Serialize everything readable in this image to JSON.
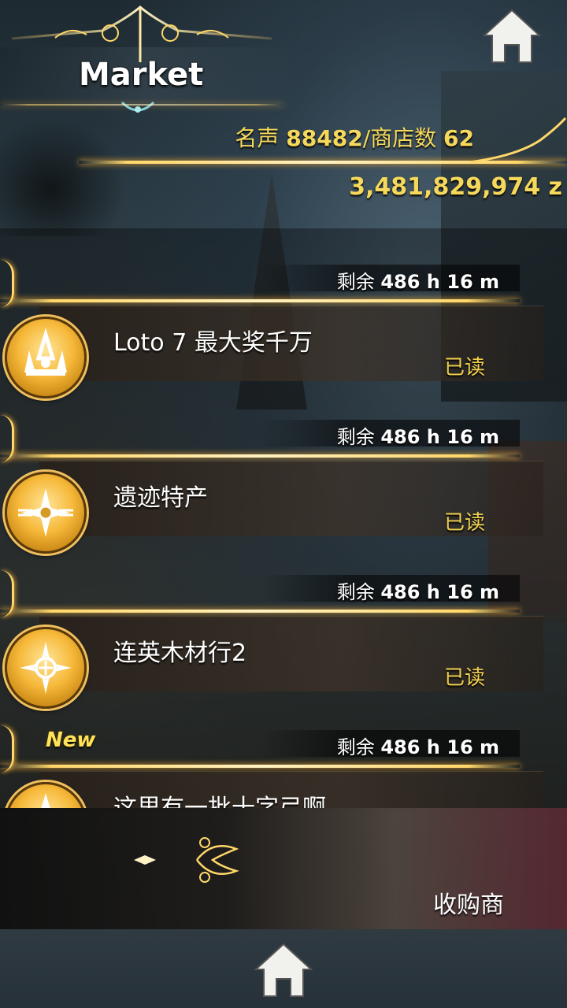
{
  "header": {
    "title": "Market",
    "home_icon": "home-icon"
  },
  "stats": {
    "fame_label": "名声",
    "fame_value": "88482",
    "shops_label": "/商店数",
    "shops_value": "62"
  },
  "money": "3,481,829,974 z",
  "entries": [
    {
      "remaining_label": "剩余",
      "remaining_value": "486 h 16 m",
      "title": "Loto 7 最大奖千万",
      "status": "已读",
      "icon": "crown-crest-icon",
      "new_badge": ""
    },
    {
      "remaining_label": "剩余",
      "remaining_value": "486 h 16 m",
      "title": "遗迹特产",
      "status": "已读",
      "icon": "compass-star-icon",
      "new_badge": ""
    },
    {
      "remaining_label": "剩余",
      "remaining_value": "486 h 16 m",
      "title": "连英木材行2",
      "status": "已读",
      "icon": "crosshair-emblem-icon",
      "new_badge": ""
    },
    {
      "remaining_label": "剩余",
      "remaining_value": "486 h 16 m",
      "title": "这里有一批十字弓啊",
      "status": "",
      "icon": "crown-crest-icon",
      "new_badge": "New"
    }
  ],
  "bottom": {
    "label": "收购商",
    "home_icon": "home-icon"
  },
  "colors": {
    "gold_text": "#f6d95b",
    "status_yellow": "#f2d14e",
    "gold_line": "#ffd76a"
  }
}
